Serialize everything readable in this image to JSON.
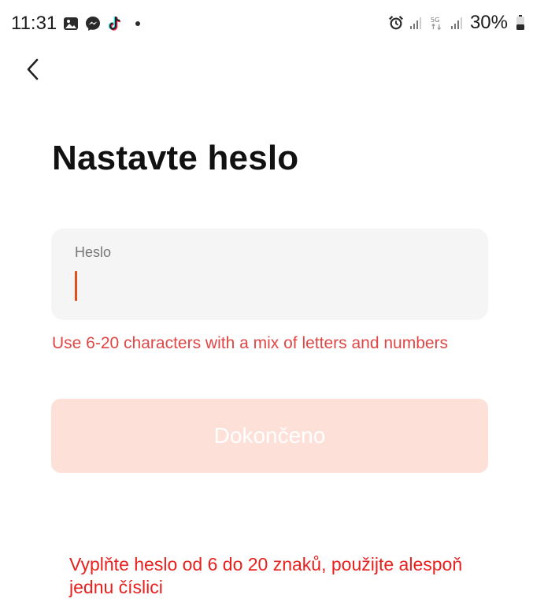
{
  "status_bar": {
    "time": "11:31",
    "battery": "30%",
    "network": "5G",
    "left_icons": [
      "gallery-icon",
      "messenger-icon",
      "tiktok-icon",
      "dot-icon"
    ],
    "right_icons": [
      "alarm-icon",
      "signal-icon",
      "5g-icon",
      "signal-icon",
      "battery-icon"
    ]
  },
  "header": {
    "title": "Nastavte heslo"
  },
  "password_field": {
    "label": "Heslo",
    "value": ""
  },
  "hint": "Use 6-20 characters with a mix of letters and numbers",
  "done_button": {
    "label": "Dokončeno"
  },
  "annotation": "Vyplňte heslo od 6 do 20 znaků, použijte alespoň jednu číslici",
  "colors": {
    "accent": "#e0501a",
    "error": "#e04646",
    "button_disabled": "#fde0d8",
    "field_bg": "#f5f5f5"
  }
}
